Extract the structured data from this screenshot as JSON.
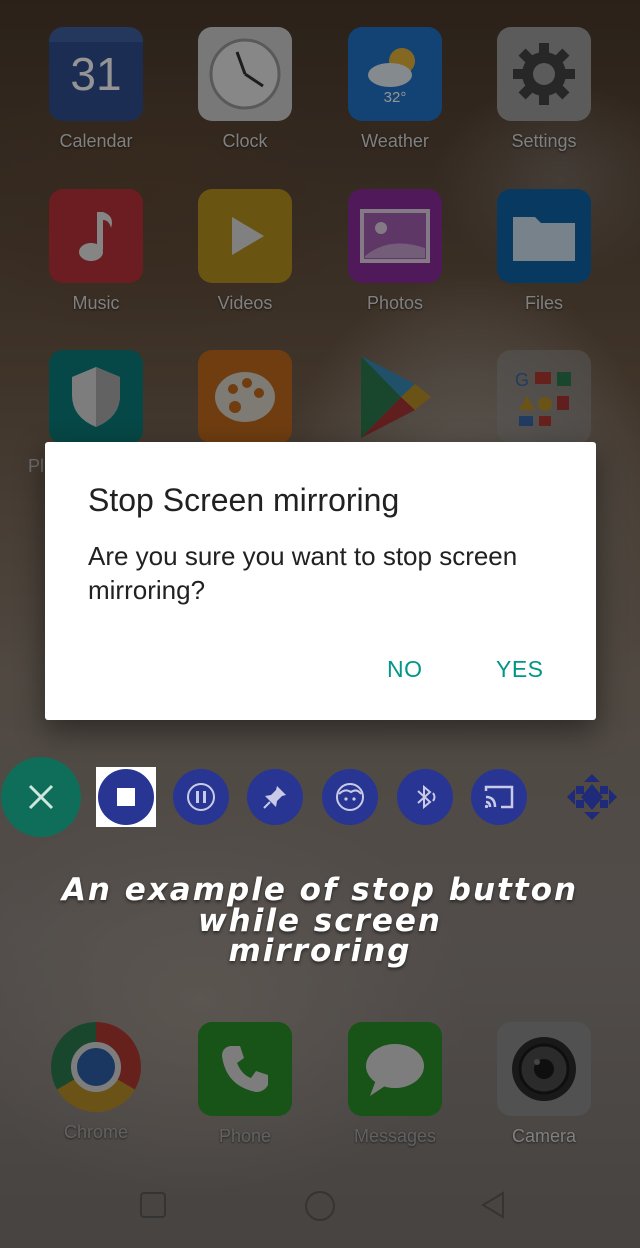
{
  "home_apps": {
    "row1": [
      {
        "label": "Calendar",
        "icon": "calendar-icon",
        "date": "31"
      },
      {
        "label": "Clock",
        "icon": "clock-icon"
      },
      {
        "label": "Weather",
        "icon": "weather-icon",
        "temp": "32°"
      },
      {
        "label": "Settings",
        "icon": "gear-icon"
      }
    ],
    "row2": [
      {
        "label": "Music",
        "icon": "music-note-icon"
      },
      {
        "label": "Videos",
        "icon": "play-icon"
      },
      {
        "label": "Photos",
        "icon": "photos-icon"
      },
      {
        "label": "Files",
        "icon": "folder-icon"
      }
    ],
    "row3_partial_label": "Pl",
    "dock": [
      {
        "label": "Chrome",
        "icon": "chrome-icon"
      },
      {
        "label": "Phone",
        "icon": "phone-icon"
      },
      {
        "label": "Messages",
        "icon": "messages-icon"
      },
      {
        "label": "Camera",
        "icon": "camera-icon"
      }
    ]
  },
  "dialog": {
    "title": "Stop Screen mirroring",
    "message": "Are you sure you want to stop screen mirroring?",
    "no_label": "NO",
    "yes_label": "YES"
  },
  "toolbar": {
    "buttons": [
      "close-icon",
      "stop-icon",
      "pause-icon",
      "pin-icon",
      "face-icon",
      "bluetooth-icon",
      "cast-icon",
      "move-arrows-icon"
    ]
  },
  "caption": {
    "line1": "An example of stop button",
    "line2": "while screen",
    "line3": "mirroring"
  },
  "colors": {
    "accent": "#009688",
    "toolbar_blue": "#283593",
    "close_green": "#0f6e5a"
  }
}
